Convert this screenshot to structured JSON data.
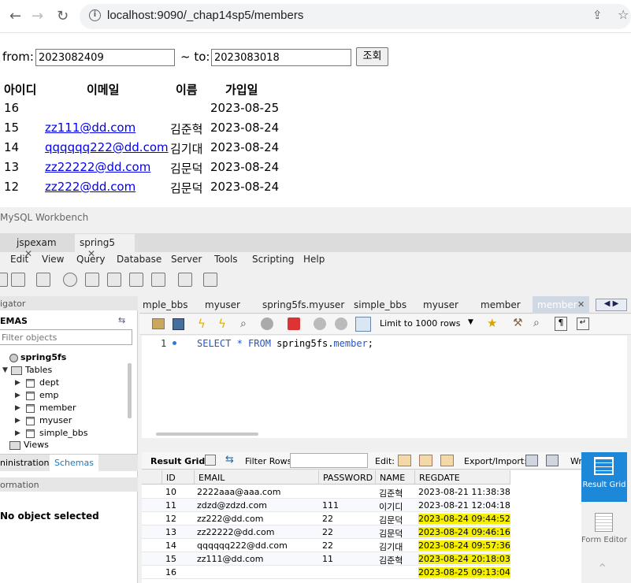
{
  "browser": {
    "url": "localhost:9090/_chap14sp5/members"
  },
  "search": {
    "from_label": "from:",
    "from_value": "2023082409",
    "to_label": "~ to:",
    "to_value": "2023083018",
    "submit_label": "조회"
  },
  "members_table": {
    "headers": [
      "아이디",
      "이메일",
      "이름",
      "가입일"
    ],
    "rows": [
      {
        "id": "16",
        "email": "",
        "name": "",
        "date": "2023-08-25"
      },
      {
        "id": "15",
        "email": "zz111@dd.com",
        "name": "김준혁",
        "date": "2023-08-24"
      },
      {
        "id": "14",
        "email": "qqqqqq222@dd.com",
        "name": "김기대",
        "date": "2023-08-24"
      },
      {
        "id": "13",
        "email": "zz22222@dd.com",
        "name": "김문덕",
        "date": "2023-08-24"
      },
      {
        "id": "12",
        "email": "zz222@dd.com",
        "name": "김문덕",
        "date": "2023-08-24"
      }
    ]
  },
  "workbench": {
    "title": "MySQL Workbench",
    "conn_tabs": [
      "jspexam",
      "spring5"
    ],
    "menu": [
      "Edit",
      "View",
      "Query",
      "Database",
      "Server",
      "Tools",
      "Scripting",
      "Help"
    ],
    "navigator_label": "igator",
    "schemas_label": "EMAS",
    "filter_placeholder": "Filter objects",
    "schema_name": "spring5fs",
    "tables_label": "Tables",
    "tables": [
      "dept",
      "emp",
      "member",
      "myuser",
      "simple_bbs"
    ],
    "views_label": "Views",
    "bottom_tabs": [
      "ninistration",
      "Schemas"
    ],
    "information_label": "ormation",
    "no_object": "No object selected",
    "editor_tabs": [
      "mple_bbs",
      "myuser",
      "spring5fs.myuser",
      "simple_bbs",
      "myuser",
      "member",
      "member"
    ],
    "limit_label": "Limit to 1000 rows",
    "sql": {
      "line_no": "1",
      "keyword": "SELECT * FROM",
      "schema": "spring5fs",
      "table": "member",
      "end": ";"
    },
    "result_grid_label": "Result Grid",
    "filter_rows_label": "Filter Rows:",
    "edit_label": "Edit:",
    "export_label": "Export/Import:",
    "wrap_label": "Wr",
    "grid": {
      "headers": [
        "ID",
        "EMAIL",
        "PASSWORD",
        "NAME",
        "REGDATE"
      ],
      "rows": [
        {
          "id": "10",
          "email": "2222aaa@aaa.com",
          "password": "",
          "name": "김준혁",
          "regdate": "2023-08-21 11:38:38",
          "hl": false
        },
        {
          "id": "11",
          "email": "zdzd@zdzd.com",
          "password": "111",
          "name": "이기디",
          "regdate": "2023-08-21 12:04:18",
          "hl": false
        },
        {
          "id": "12",
          "email": "zz222@dd.com",
          "password": "22",
          "name": "김문덕",
          "regdate": "2023-08-24 09:44:52",
          "hl": true
        },
        {
          "id": "13",
          "email": "zz22222@dd.com",
          "password": "22",
          "name": "김문덕",
          "regdate": "2023-08-24 09:46:16",
          "hl": true
        },
        {
          "id": "14",
          "email": "qqqqqq222@dd.com",
          "password": "22",
          "name": "김기대",
          "regdate": "2023-08-24 09:57:36",
          "hl": true
        },
        {
          "id": "15",
          "email": "zz111@dd.com",
          "password": "11",
          "name": "김준혁",
          "regdate": "2023-08-24 20:18:03",
          "hl": true
        },
        {
          "id": "16",
          "email": "",
          "password": "",
          "name": "",
          "regdate": "2023-08-25 09:13:04",
          "hl": true
        }
      ]
    },
    "side_buttons": [
      "Result Grid",
      "Form Editor"
    ],
    "highlight_color": "#f5f000"
  }
}
